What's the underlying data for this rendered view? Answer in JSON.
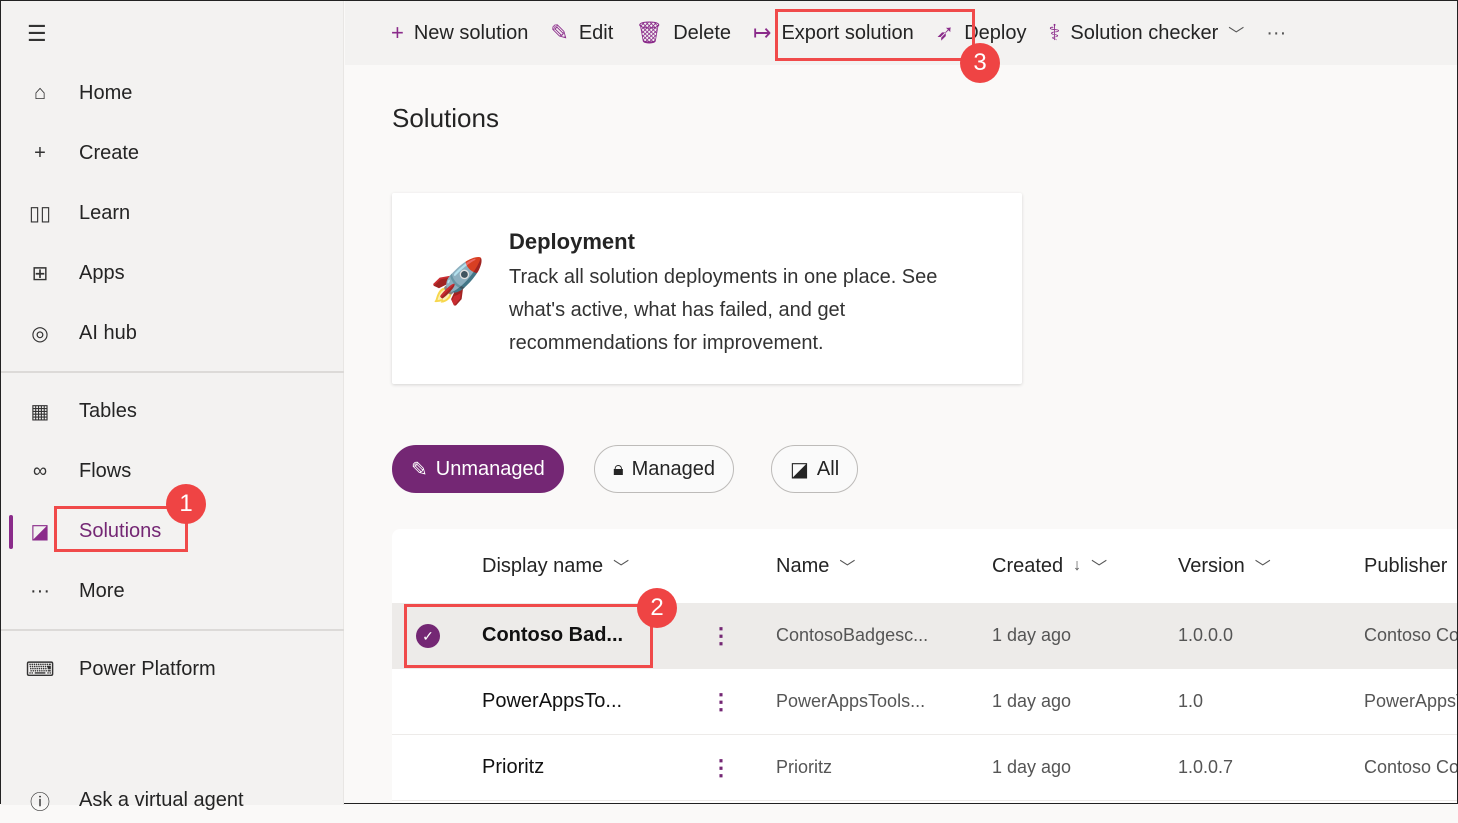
{
  "sidebar": {
    "items": [
      {
        "label": "Home",
        "icon": "home-icon",
        "glyph": "⌂"
      },
      {
        "label": "Create",
        "icon": "plus-icon",
        "glyph": "+"
      },
      {
        "label": "Learn",
        "icon": "book-icon",
        "glyph": "▯▯"
      },
      {
        "label": "Apps",
        "icon": "apps-icon",
        "glyph": "⊞"
      },
      {
        "label": "AI hub",
        "icon": "brain-icon",
        "glyph": "◎"
      },
      {
        "label": "Tables",
        "icon": "table-icon",
        "glyph": "▦"
      },
      {
        "label": "Flows",
        "icon": "flow-icon",
        "glyph": "∞"
      },
      {
        "label": "Solutions",
        "icon": "solutions-icon",
        "glyph": "◪"
      },
      {
        "label": "More",
        "icon": "more-icon",
        "glyph": "···"
      },
      {
        "label": "Power Platform",
        "icon": "power-platform-icon",
        "glyph": "⌨"
      },
      {
        "label": "Ask a virtual agent",
        "icon": "help-icon",
        "glyph": "?"
      }
    ]
  },
  "commands": [
    {
      "label": "New solution",
      "glyph": "+"
    },
    {
      "label": "Edit",
      "glyph": "✎"
    },
    {
      "label": "Delete",
      "glyph": "🗑"
    },
    {
      "label": "Export solution",
      "glyph": "↦"
    },
    {
      "label": "Deploy",
      "glyph": "🚀"
    },
    {
      "label": "Solution checker",
      "glyph": "⚕"
    }
  ],
  "page_title": "Solutions",
  "card": {
    "title": "Deployment",
    "description": "Track all solution deployments in one place. See what's active, what has failed, and get recommendations for improvement."
  },
  "filters": [
    "Unmanaged",
    "Managed",
    "All"
  ],
  "table": {
    "columns": [
      "Display name",
      "Name",
      "Created",
      "Version",
      "Publisher"
    ],
    "rows": [
      {
        "display": "Contoso Bad...",
        "name": "ContosoBadgesc...",
        "created": "1 day ago",
        "version": "1.0.0.0",
        "publisher": "Contoso Co"
      },
      {
        "display": "PowerAppsTo...",
        "name": "PowerAppsTools...",
        "created": "1 day ago",
        "version": "1.0",
        "publisher": "PowerAppsT"
      },
      {
        "display": "Prioritz",
        "name": "Prioritz",
        "created": "1 day ago",
        "version": "1.0.0.7",
        "publisher": "Contoso Co"
      }
    ]
  },
  "callouts": [
    "1",
    "2",
    "3"
  ],
  "accent": "#742774"
}
